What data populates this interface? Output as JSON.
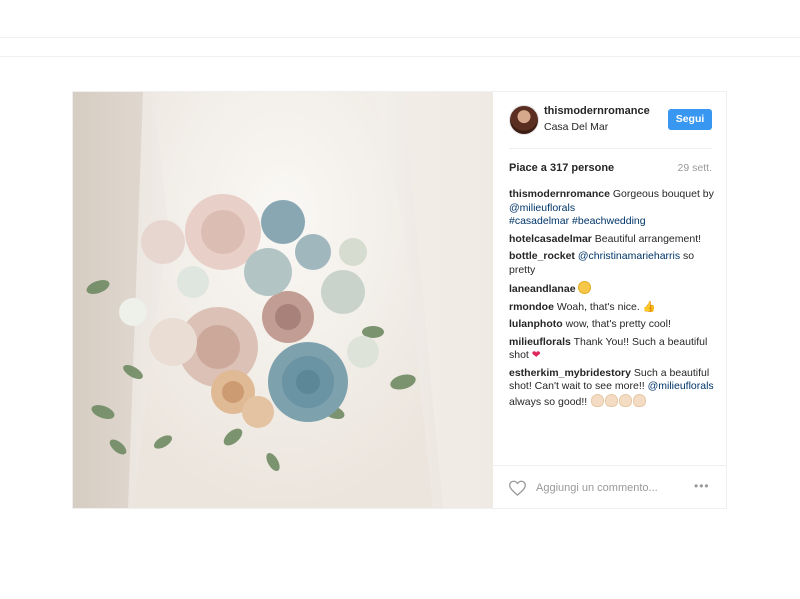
{
  "post": {
    "username": "thismodernromance",
    "location": "Casa Del Mar",
    "follow_label": "Segui",
    "likes_text": "Piace a 317 persone",
    "date": "29 sett.",
    "add_comment_placeholder": "Aggiungi un commento...",
    "more_label": "•••"
  },
  "comments": [
    {
      "user": "thismodernromance",
      "text_parts": [
        "Gorgeous bouquet by ",
        "@milieuflorals",
        " ",
        "#casadelmar",
        " ",
        "#beachwedding"
      ]
    },
    {
      "user": "hotelcasadelmar",
      "text": "Beautiful arrangement!"
    },
    {
      "user": "bottle_rocket",
      "mention": "@christinamarieharris",
      "after": " so pretty"
    },
    {
      "user": "laneandlanae",
      "text": "",
      "emoji": "smile-emoji"
    },
    {
      "user": "rmondoe",
      "text": "Woah, that's nice. ",
      "emoji": "thumbs-up-emoji",
      "emoji_char": "👍"
    },
    {
      "user": "lulanphoto",
      "text": "wow, that's pretty cool!"
    },
    {
      "user": "milieuflorals",
      "text": "Thank You!! Such a beautiful shot ",
      "emoji": "heart-emoji",
      "emoji_char": "❤"
    },
    {
      "user": "estherkim_mybridestory",
      "text": "Such a beautiful shot! Can't wait to see more!! ",
      "mention": "@milieuflorals",
      "after": " always so good!! ",
      "emoji": "clapping-emoji"
    }
  ],
  "colors": {
    "follow_button": "#3897f0",
    "link": "#003569",
    "date": "#999999"
  },
  "icons": [
    "heart-icon",
    "more-options-icon"
  ]
}
